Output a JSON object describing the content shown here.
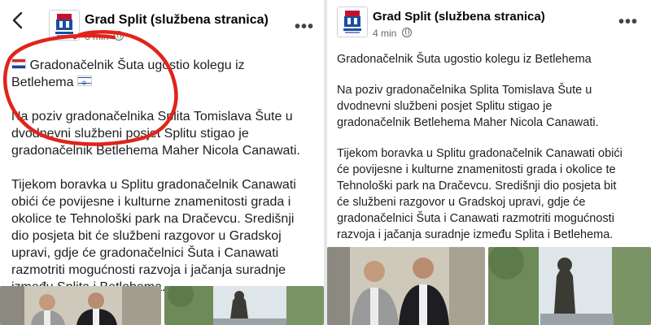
{
  "left": {
    "back_icon": "arrow-left-icon",
    "page_name": "Grad Split (službena stranica)",
    "timestamp": "6 min",
    "more_icon": "more-horizontal-icon",
    "title_line1": "Gradonačelnik Šuta ugostio kolegu iz",
    "title_line2": "Betlehema",
    "flags": [
      "croatian-flag",
      "israeli-flag"
    ],
    "paragraph1": [
      "Na poziv gradonačelnika Splita Tomislava Šute u",
      "dvodnevni službeni posjet Splitu stigao je",
      "gradonačelnik Betlehema Maher Nicola Canawati."
    ],
    "paragraph2": [
      "Tijekom boravka u Splitu gradonačelnik Canawati",
      "obići će povijesne i kulturne znamenitosti grada i",
      "okolice te Tehnološki park na Dračevcu. Središnji",
      "dio posjeta bit će službeni razgovor u Gradskoj",
      "upravi, gdje će gradonačelnici Šuta i Canawati",
      "razmotriti mogućnosti razvoja i jačanja suradnje",
      "između Splita i Betlehema."
    ]
  },
  "right": {
    "page_name": "Grad Split (službena stranica)",
    "timestamp": "4 min",
    "more_icon": "more-horizontal-icon",
    "title": "Gradonačelnik Šuta ugostio kolegu iz Betlehema",
    "paragraph1": [
      "Na poziv gradonačelnika Splita Tomislava Šute u",
      "dvodnevni službeni posjet Splitu stigao je",
      "gradonačelnik Betlehema Maher Nicola Canawati."
    ],
    "paragraph2": [
      "Tijekom boravka u Splitu gradonačelnik Canawati obići",
      "će povijesne i kulturne znamenitosti grada i okolice te",
      "Tehnološki park na Dračevcu. Središnji dio posjeta bit",
      "će službeni razgovor u Gradskoj upravi, gdje će",
      "gradonačelnici Šuta i Canawati razmotriti mogućnosti",
      "razvoja i jačanja suradnje između Splita i Betlehema."
    ]
  },
  "colors": {
    "annotation_red": "#e0241b",
    "meta_gray": "#65676b",
    "text": "#1c1e21"
  }
}
